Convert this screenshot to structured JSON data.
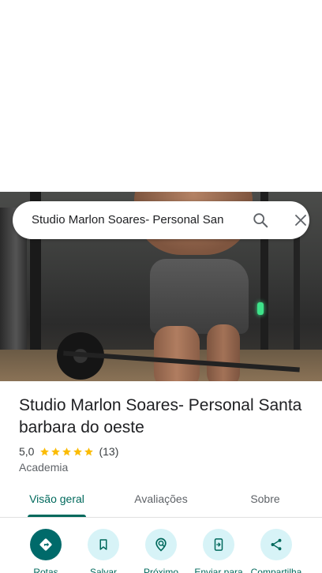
{
  "search": {
    "query": "Studio Marlon Soares- Personal San"
  },
  "place": {
    "name": "Studio Marlon Soares- Personal Santa barbara do oeste",
    "rating": "5,0",
    "review_count": "(13)",
    "stars": 5,
    "category": "Academia"
  },
  "tabs": [
    {
      "label": "Visão geral",
      "active": true
    },
    {
      "label": "Avaliações",
      "active": false
    },
    {
      "label": "Sobre",
      "active": false
    }
  ],
  "actions": [
    {
      "label": "Rotas",
      "icon": "directions-icon"
    },
    {
      "label": "Salvar",
      "icon": "bookmark-icon"
    },
    {
      "label": "Próximo",
      "icon": "nearby-icon"
    },
    {
      "label": "Enviar para",
      "icon": "send-to-phone-icon"
    },
    {
      "label": "Compartilha",
      "icon": "share-icon"
    }
  ],
  "colors": {
    "accent": "#00695c",
    "primary_button": "#006a6a",
    "action_circle": "#d7f3f7",
    "star": "#fbbc04"
  }
}
